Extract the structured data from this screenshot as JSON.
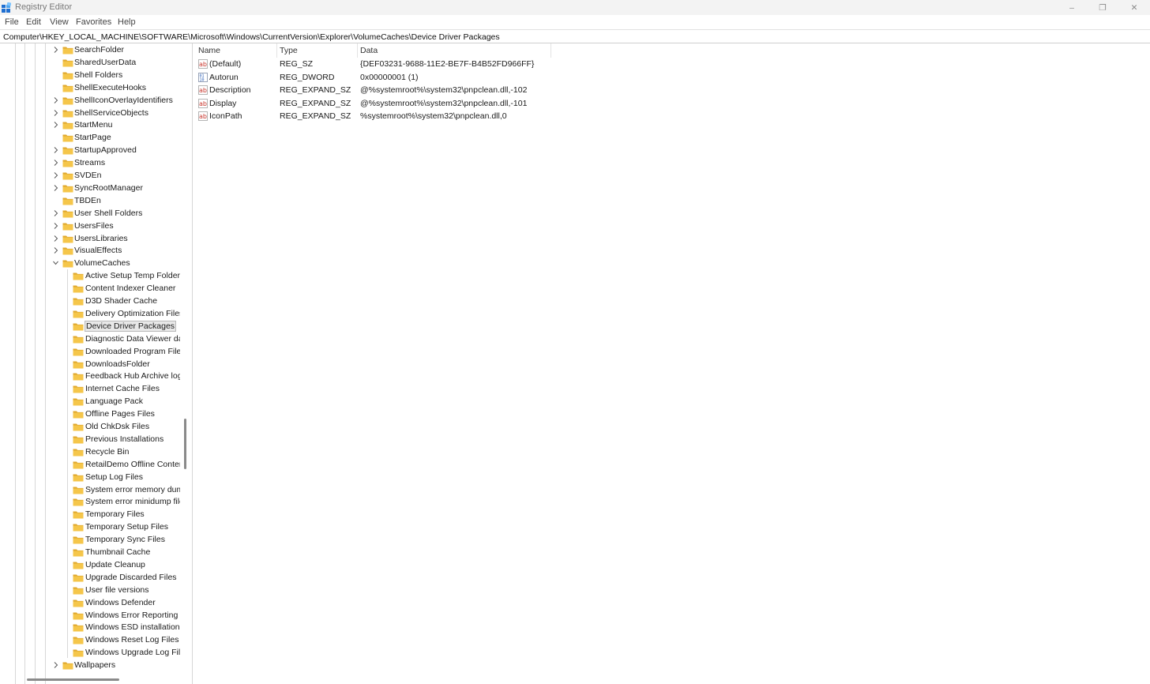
{
  "window": {
    "title": "Registry Editor",
    "controls": {
      "minimize": "–",
      "maximize": "❐",
      "close": "✕"
    }
  },
  "menu": [
    "File",
    "Edit",
    "View",
    "Favorites",
    "Help"
  ],
  "address": "Computer\\HKEY_LOCAL_MACHINE\\SOFTWARE\\Microsoft\\Windows\\CurrentVersion\\Explorer\\VolumeCaches\\Device Driver Packages",
  "tree": {
    "parent_items": [
      {
        "label": "SearchFolder",
        "expandable": true
      },
      {
        "label": "SharedUserData",
        "expandable": false
      },
      {
        "label": "Shell Folders",
        "expandable": false
      },
      {
        "label": "ShellExecuteHooks",
        "expandable": false
      },
      {
        "label": "ShellIconOverlayIdentifiers",
        "expandable": true
      },
      {
        "label": "ShellServiceObjects",
        "expandable": true
      },
      {
        "label": "StartMenu",
        "expandable": true
      },
      {
        "label": "StartPage",
        "expandable": false
      },
      {
        "label": "StartupApproved",
        "expandable": true
      },
      {
        "label": "Streams",
        "expandable": true
      },
      {
        "label": "SVDEn",
        "expandable": true
      },
      {
        "label": "SyncRootManager",
        "expandable": true
      },
      {
        "label": "TBDEn",
        "expandable": false
      },
      {
        "label": "User Shell Folders",
        "expandable": true
      },
      {
        "label": "UsersFiles",
        "expandable": true
      },
      {
        "label": "UsersLibraries",
        "expandable": true
      },
      {
        "label": "VisualEffects",
        "expandable": true
      },
      {
        "label": "VolumeCaches",
        "expandable": true,
        "expanded": true
      }
    ],
    "children": [
      "Active Setup Temp Folders",
      "Content Indexer Cleaner",
      "D3D Shader Cache",
      "Delivery Optimization Files",
      "Device Driver Packages",
      "Diagnostic Data Viewer da",
      "Downloaded Program Files",
      "DownloadsFolder",
      "Feedback Hub Archive log",
      "Internet Cache Files",
      "Language Pack",
      "Offline Pages Files",
      "Old ChkDsk Files",
      "Previous Installations",
      "Recycle Bin",
      "RetailDemo Offline Conten",
      "Setup Log Files",
      "System error memory dum",
      "System error minidump file",
      "Temporary Files",
      "Temporary Setup Files",
      "Temporary Sync Files",
      "Thumbnail Cache",
      "Update Cleanup",
      "Upgrade Discarded Files",
      "User file versions",
      "Windows Defender",
      "Windows Error Reporting F",
      "Windows ESD installation f",
      "Windows Reset Log Files",
      "Windows Upgrade Log File"
    ],
    "selected_child": "Device Driver Packages",
    "after_items": [
      {
        "label": "Wallpapers",
        "expandable": true
      }
    ]
  },
  "values": {
    "columns": {
      "name": "Name",
      "type": "Type",
      "data": "Data"
    },
    "rows": [
      {
        "name": "(Default)",
        "type": "REG_SZ",
        "data": "{DEF03231-9688-11E2-BE7F-B4B52FD966FF}",
        "icon": "string-value-icon"
      },
      {
        "name": "Autorun",
        "type": "REG_DWORD",
        "data": "0x00000001 (1)",
        "icon": "binary-value-icon"
      },
      {
        "name": "Description",
        "type": "REG_EXPAND_SZ",
        "data": "@%systemroot%\\system32\\pnpclean.dll,-102",
        "icon": "string-value-icon"
      },
      {
        "name": "Display",
        "type": "REG_EXPAND_SZ",
        "data": "@%systemroot%\\system32\\pnpclean.dll,-101",
        "icon": "string-value-icon"
      },
      {
        "name": "IconPath",
        "type": "REG_EXPAND_SZ",
        "data": "%systemroot%\\system32\\pnpclean.dll,0",
        "icon": "string-value-icon"
      }
    ]
  },
  "colors": {
    "folder": "#f5c64a",
    "folder_dark": "#e0a82e",
    "selection_bg": "#e8e8e8",
    "scrollbar": "#8a8a8a",
    "string_icon": "#c8342b",
    "dword_icon": "#2b5fb8"
  }
}
